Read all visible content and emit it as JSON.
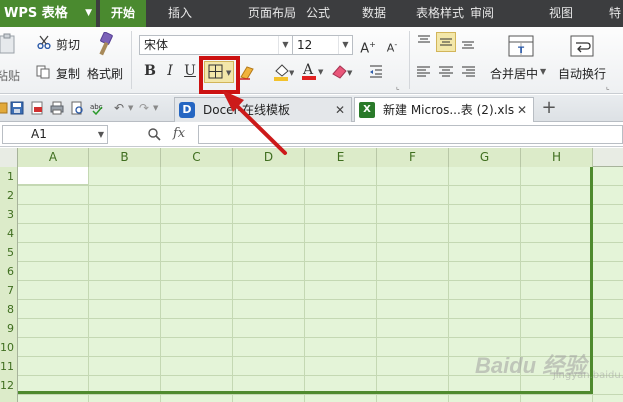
{
  "app": {
    "title": "WPS 表格",
    "brand_color": "#4a8a2f"
  },
  "menu": [
    {
      "label": "开始",
      "active": true
    },
    {
      "label": "插入",
      "active": false
    },
    {
      "label": "页面布局",
      "active": false
    },
    {
      "label": "公式",
      "active": false
    },
    {
      "label": "数据",
      "active": false
    },
    {
      "label": "表格样式",
      "active": false
    },
    {
      "label": "审阅",
      "active": false
    },
    {
      "label": "视图",
      "active": false
    },
    {
      "label": "特",
      "active": false
    }
  ],
  "ribbon": {
    "paste_label": "粘贴",
    "cut_label": "剪切",
    "copy_label": "复制",
    "format_painter_label": "格式刷",
    "font_name": "宋体",
    "font_size": "12",
    "bold_label": "B",
    "italic_label": "I",
    "underline_label": "U",
    "merge_center_label": "合并居中",
    "wrap_text_label": "自动换行"
  },
  "tabs": [
    {
      "label": "Docer-在线模板",
      "active": false
    },
    {
      "label": "新建 Micros...表 (2).xls",
      "active": true
    }
  ],
  "formula_bar": {
    "cell_ref": "A1",
    "fx_label": "fx",
    "value": ""
  },
  "grid": {
    "columns": [
      "A",
      "B",
      "C",
      "D",
      "E",
      "F",
      "G",
      "H"
    ],
    "rows": [
      "1",
      "2",
      "3",
      "4",
      "5",
      "6",
      "7",
      "8",
      "9",
      "10",
      "11",
      "12"
    ],
    "selection_color": "#e4f4d8"
  },
  "annotation": {
    "highlight_color": "#cc1111",
    "target": "borders-button"
  },
  "watermark": {
    "text": "Baidu 经验",
    "sub": "jingyan.baidu.com"
  }
}
